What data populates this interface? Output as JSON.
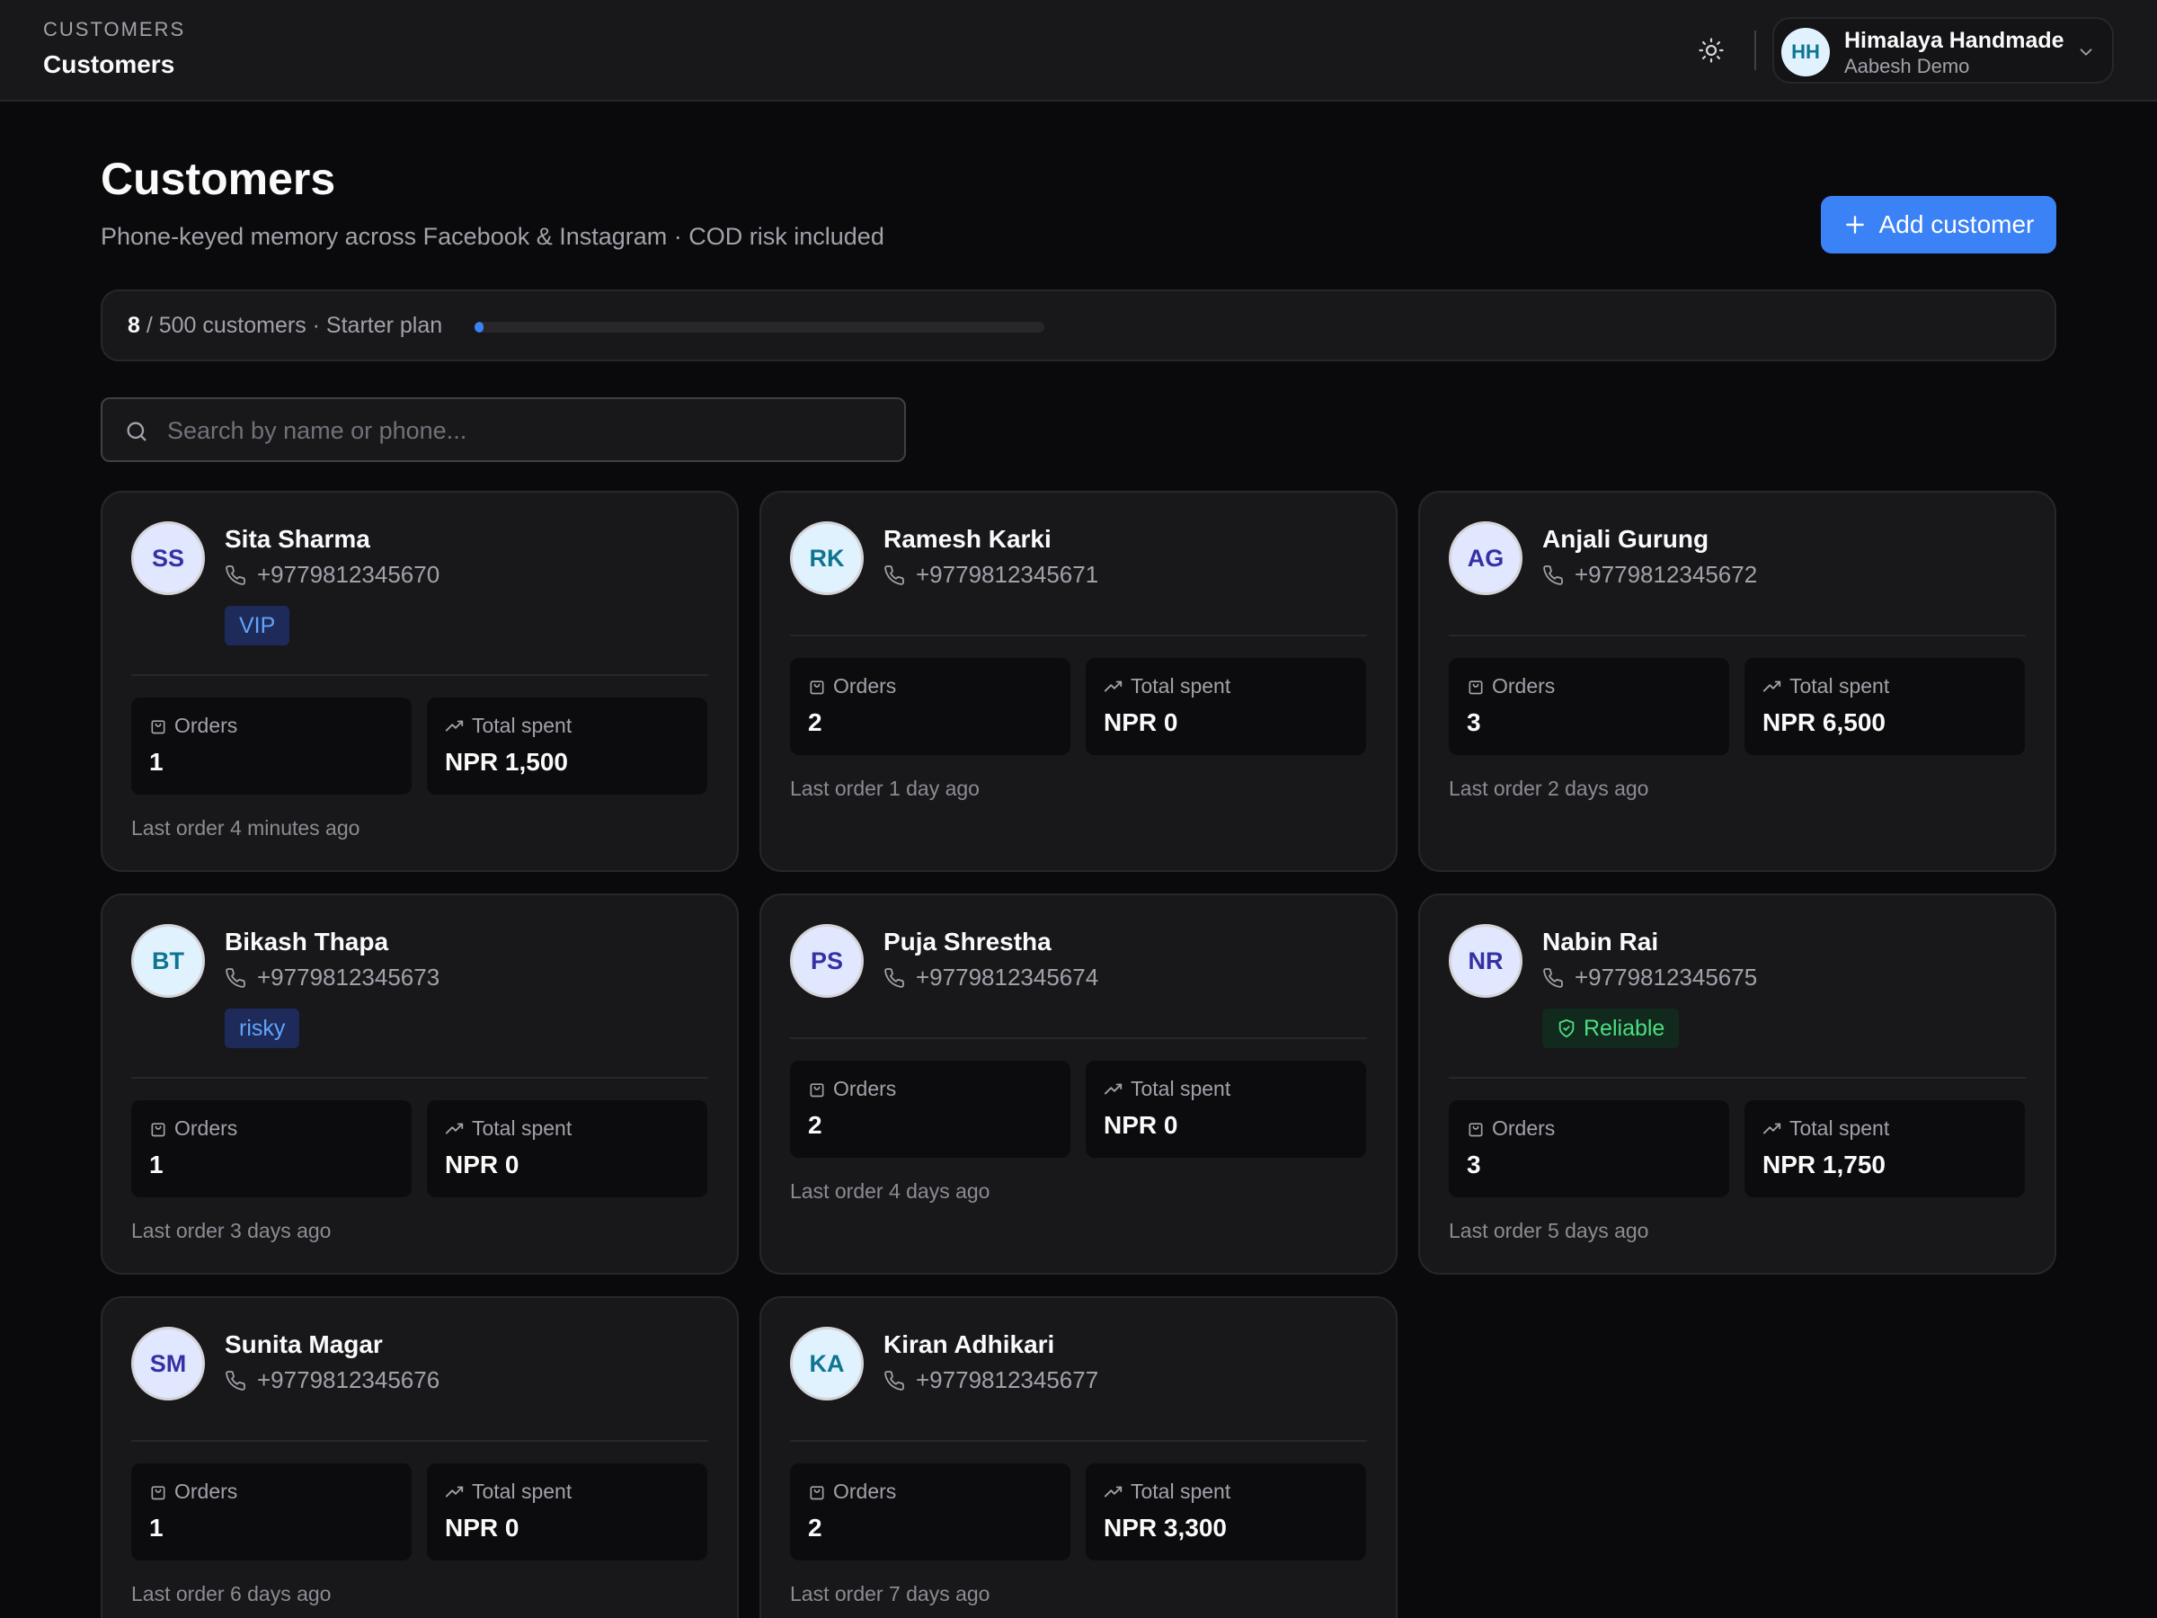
{
  "header": {
    "section": "CUSTOMERS",
    "page": "Customers",
    "org": {
      "initials": "HH",
      "name": "Himalaya Handmade",
      "sub": "Aabesh Demo"
    }
  },
  "page": {
    "title": "Customers",
    "subtitle": "Phone-keyed memory across Facebook & Instagram · COD risk included",
    "add_button": "Add customer"
  },
  "usage": {
    "current": "8",
    "rest": " / 500 customers · Starter plan",
    "fraction": 0.016
  },
  "search": {
    "placeholder": "Search by name or phone..."
  },
  "labels": {
    "orders": "Orders",
    "total_spent": "Total spent"
  },
  "colors": {
    "accent": "#3b82f6",
    "vip": "#60a5fa",
    "reliable": "#4ade80"
  },
  "customers": [
    {
      "initials": "SS",
      "name": "Sita Sharma",
      "phone": "+9779812345670",
      "badge": "VIP",
      "badge_type": "blue",
      "orders": "1",
      "spent": "NPR 1,500",
      "last_order": "Last order 4 minutes ago",
      "avatar_bg": "#e0e7ff",
      "avatar_fg": "#3730a3"
    },
    {
      "initials": "RK",
      "name": "Ramesh Karki",
      "phone": "+9779812345671",
      "badge": "",
      "badge_type": "",
      "orders": "2",
      "spent": "NPR 0",
      "last_order": "Last order 1 day ago",
      "avatar_bg": "#e0f2fe",
      "avatar_fg": "#0e7490"
    },
    {
      "initials": "AG",
      "name": "Anjali Gurung",
      "phone": "+9779812345672",
      "badge": "",
      "badge_type": "",
      "orders": "3",
      "spent": "NPR 6,500",
      "last_order": "Last order 2 days ago",
      "avatar_bg": "#e0e7ff",
      "avatar_fg": "#3730a3"
    },
    {
      "initials": "BT",
      "name": "Bikash Thapa",
      "phone": "+9779812345673",
      "badge": "risky",
      "badge_type": "blue",
      "orders": "1",
      "spent": "NPR 0",
      "last_order": "Last order 3 days ago",
      "avatar_bg": "#e0f2fe",
      "avatar_fg": "#0e7490"
    },
    {
      "initials": "PS",
      "name": "Puja Shrestha",
      "phone": "+9779812345674",
      "badge": "",
      "badge_type": "",
      "orders": "2",
      "spent": "NPR 0",
      "last_order": "Last order 4 days ago",
      "avatar_bg": "#e0e7ff",
      "avatar_fg": "#3730a3"
    },
    {
      "initials": "NR",
      "name": "Nabin Rai",
      "phone": "+9779812345675",
      "badge": "Reliable",
      "badge_type": "green",
      "orders": "3",
      "spent": "NPR 1,750",
      "last_order": "Last order 5 days ago",
      "avatar_bg": "#e0e7ff",
      "avatar_fg": "#3730a3"
    },
    {
      "initials": "SM",
      "name": "Sunita Magar",
      "phone": "+9779812345676",
      "badge": "",
      "badge_type": "",
      "orders": "1",
      "spent": "NPR 0",
      "last_order": "Last order 6 days ago",
      "avatar_bg": "#e0e7ff",
      "avatar_fg": "#3730a3"
    },
    {
      "initials": "KA",
      "name": "Kiran Adhikari",
      "phone": "+9779812345677",
      "badge": "",
      "badge_type": "",
      "orders": "2",
      "spent": "NPR 3,300",
      "last_order": "Last order 7 days ago",
      "avatar_bg": "#e0f2fe",
      "avatar_fg": "#0e7490"
    }
  ]
}
